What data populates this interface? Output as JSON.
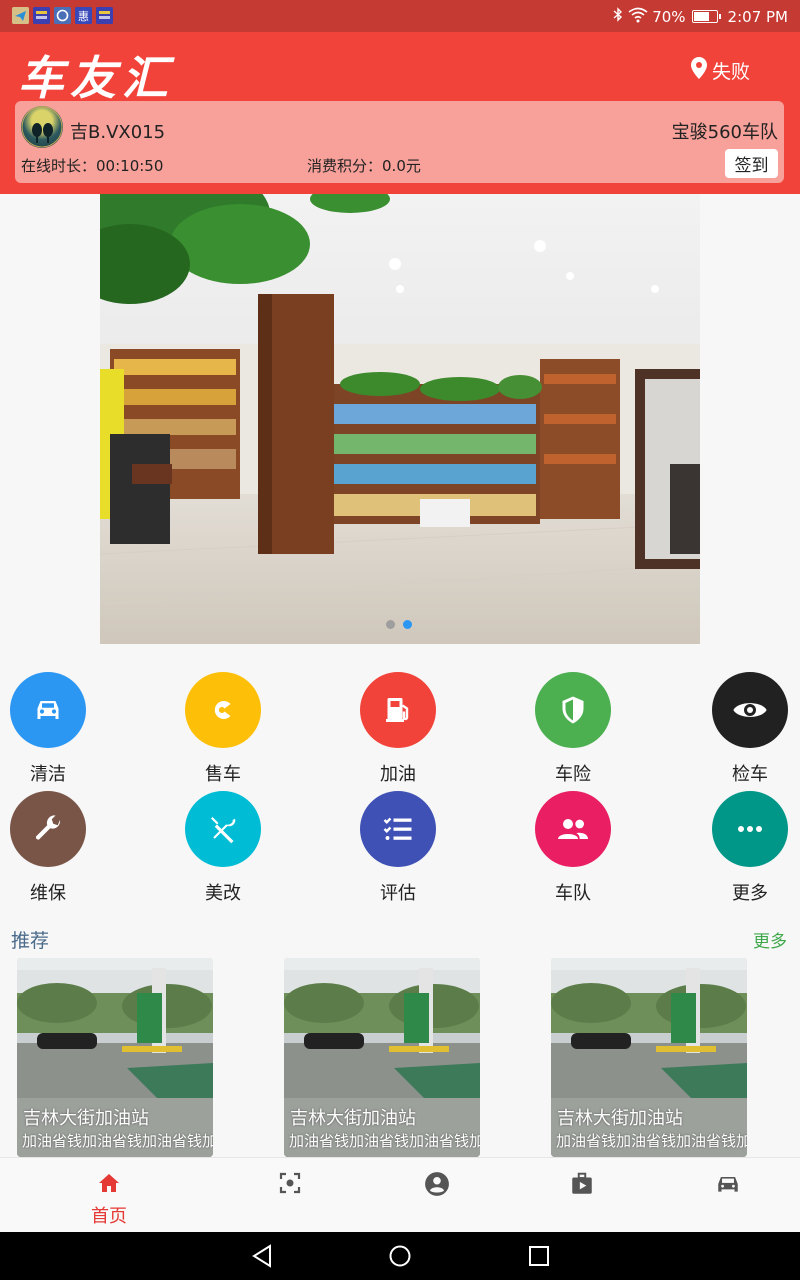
{
  "status_bar": {
    "battery_percent_label": "70%",
    "battery_level": 0.7,
    "time": "2:07 PM",
    "notification_icons": [
      "telegram-icon",
      "app-badge-icon",
      "browser-icon",
      "app-hui-icon",
      "app-badge-icon"
    ]
  },
  "header": {
    "app_title": "车友汇",
    "location_label": "失败",
    "background_color": "#f2433a"
  },
  "user": {
    "plate": "吉B.VX015",
    "team": "宝骏560车队",
    "online_label": "在线时长：",
    "online_value": "00:10:50",
    "points_label": "消费积分：",
    "points_value": "0.0元",
    "checkin_label": "签到"
  },
  "banner": {
    "slide_count": 2,
    "active_slide": 2
  },
  "services": [
    {
      "label": "清洁",
      "icon": "car-icon",
      "color": "#2c97f3"
    },
    {
      "label": "售车",
      "icon": "sale-icon",
      "color": "#fdbf08"
    },
    {
      "label": "加油",
      "icon": "fuel-icon",
      "color": "#f2433a"
    },
    {
      "label": "车险",
      "icon": "shield-icon",
      "color": "#4caf50"
    },
    {
      "label": "检车",
      "icon": "eye-icon",
      "color": "#212121"
    },
    {
      "label": "维保",
      "icon": "wrench-icon",
      "color": "#795548"
    },
    {
      "label": "美改",
      "icon": "tools-icon",
      "color": "#00bcd4"
    },
    {
      "label": "评估",
      "icon": "checklist-icon",
      "color": "#3f51b5"
    },
    {
      "label": "车队",
      "icon": "team-icon",
      "color": "#e91e63"
    },
    {
      "label": "更多",
      "icon": "more-icon",
      "color": "#009688"
    }
  ],
  "recommend": {
    "title": "推荐",
    "more_label": "更多",
    "items": [
      {
        "name": "吉林大街加油站",
        "desc": "加油省钱加油省钱加油省钱加油省"
      },
      {
        "name": "吉林大街加油站",
        "desc": "加油省钱加油省钱加油省钱加油省"
      },
      {
        "name": "吉林大街加油站",
        "desc": "加油省钱加油省钱加油省钱加油省"
      }
    ]
  },
  "bottom_nav": {
    "items": [
      {
        "label": "首页",
        "icon": "home-icon",
        "active": true
      },
      {
        "label": "",
        "icon": "scan-icon",
        "active": false
      },
      {
        "label": "",
        "icon": "account-icon",
        "active": false
      },
      {
        "label": "",
        "icon": "video-bag-icon",
        "active": false
      },
      {
        "label": "",
        "icon": "car-icon",
        "active": false
      }
    ],
    "active_color": "#e53935",
    "inactive_color": "#555555"
  },
  "android_nav": {
    "buttons": [
      "back-icon",
      "home-circle-icon",
      "recents-icon"
    ]
  }
}
